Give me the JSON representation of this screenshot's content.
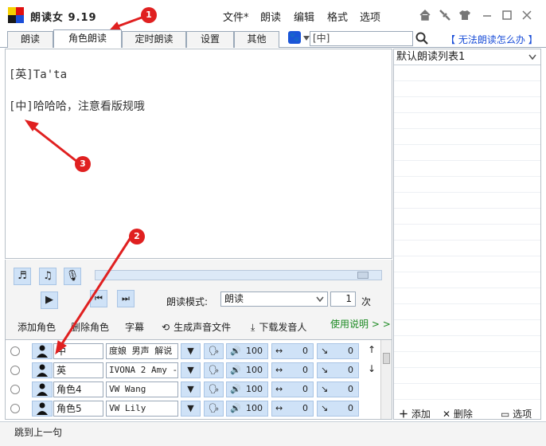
{
  "app": {
    "title": "朗读女 9.19"
  },
  "menu": [
    "文件*",
    "朗读",
    "编辑",
    "格式",
    "选项"
  ],
  "window_icons": [
    "home-icon",
    "satellite-icon",
    "shirt-icon",
    "minimize-icon",
    "maximize-icon",
    "close-icon"
  ],
  "tabs": [
    {
      "label": "朗读",
      "active": false
    },
    {
      "label": "角色朗读",
      "active": true
    },
    {
      "label": "定时朗读",
      "active": false
    },
    {
      "label": "设置",
      "active": false
    },
    {
      "label": "其他",
      "active": false
    }
  ],
  "search": {
    "value": "[中]"
  },
  "help_link": "【 无法朗读怎么办 】",
  "text_lines": [
    "[英]Ta'ta",
    "[中]哈哈哈，注意看版规哦"
  ],
  "right_panel": {
    "list_name": "默认朗读列表1",
    "add_label": "添加",
    "delete_label": "删除",
    "options_label": "选项"
  },
  "controls": {
    "mode_label": "朗读模式:",
    "mode_value": "朗读",
    "times_value": "1",
    "times_unit": "次",
    "add_role": "添加角色",
    "delete_role": "删除角色",
    "subtitle": "字幕",
    "generate_audio": "生成声音文件",
    "download_speaker": "下载发音人",
    "usage": "使用说明"
  },
  "roles": [
    {
      "name": "中",
      "voice": "度娘 男声 解说",
      "volume": "100",
      "speed": "0",
      "pitch": "0"
    },
    {
      "name": "英",
      "voice": "IVONA 2 Amy - ",
      "volume": "100",
      "speed": "0",
      "pitch": "0"
    },
    {
      "name": "角色4",
      "voice": "VW Wang",
      "volume": "100",
      "speed": "0",
      "pitch": "0"
    },
    {
      "name": "角色5",
      "voice": "VW Lily",
      "volume": "100",
      "speed": "0",
      "pitch": "0"
    }
  ],
  "status": {
    "text": "跳到上一句"
  },
  "annotations": [
    "1",
    "2",
    "3"
  ],
  "colors": {
    "accent_blue": "#1a4ed8",
    "annotation_red": "#e02020",
    "usage_green": "#1c8a22"
  }
}
